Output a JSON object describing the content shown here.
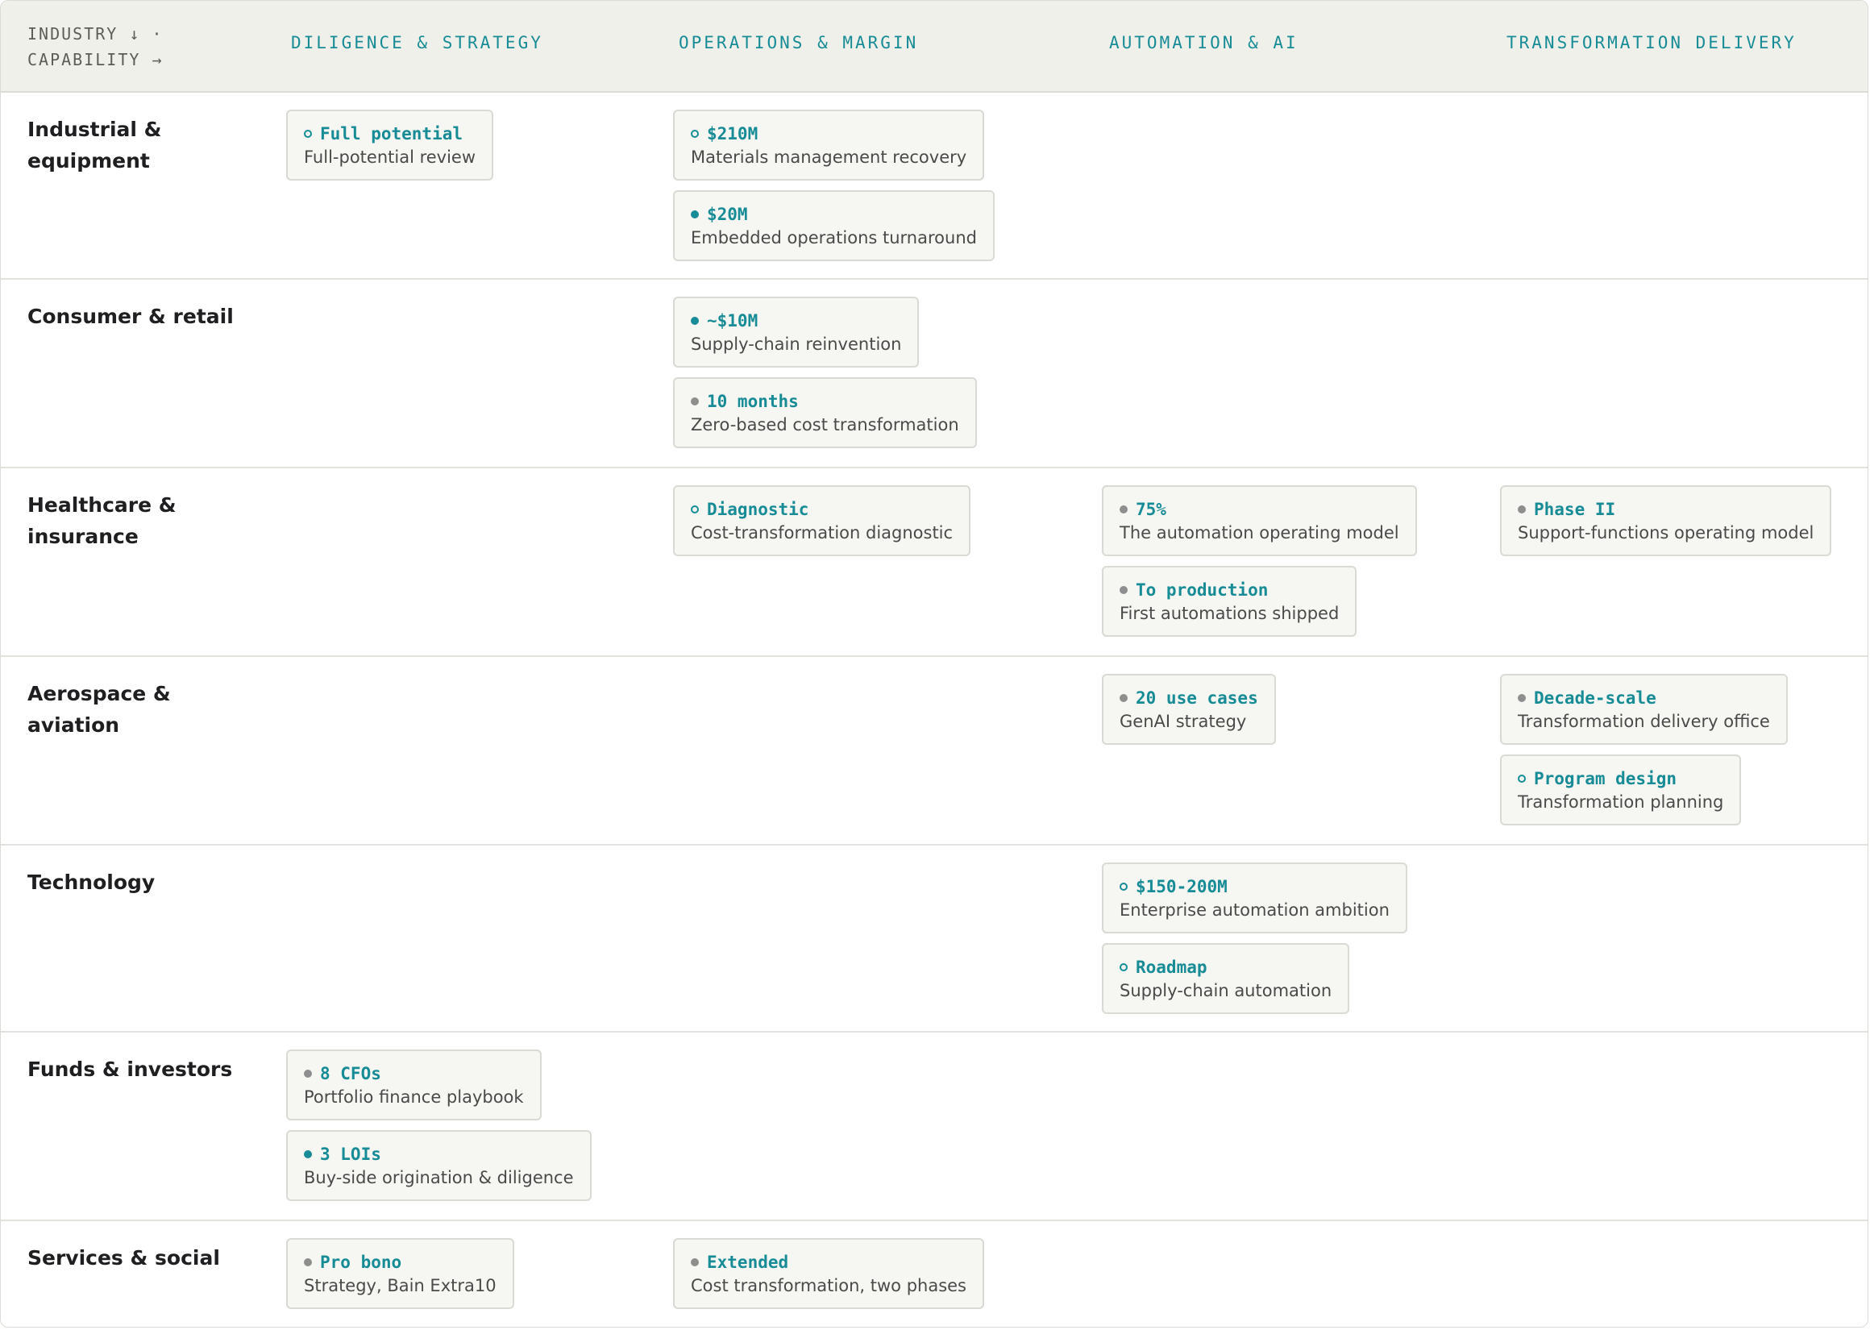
{
  "header": {
    "corner_line1": "INDUSTRY ↓ ·",
    "corner_line2": "CAPABILITY →",
    "columns": [
      "DILIGENCE & STRATEGY",
      "OPERATIONS & MARGIN",
      "AUTOMATION & AI",
      "TRANSFORMATION DELIVERY"
    ]
  },
  "rows": [
    {
      "label": "Industrial & equipment",
      "cells": [
        [
          {
            "status": "outline",
            "metric": "Full potential",
            "desc": "Full-potential review"
          }
        ],
        [
          {
            "status": "outline",
            "metric": "$210M",
            "desc": "Materials management recovery"
          },
          {
            "status": "filled",
            "metric": "$20M",
            "desc": "Embedded operations turnaround"
          }
        ],
        [],
        []
      ]
    },
    {
      "label": "Consumer & retail",
      "cells": [
        [],
        [
          {
            "status": "filled",
            "metric": "~$10M",
            "desc": "Supply-chain reinvention"
          },
          {
            "status": "grey",
            "metric": "10 months",
            "desc": "Zero-based cost transformation"
          }
        ],
        [],
        []
      ]
    },
    {
      "label": "Healthcare & insurance",
      "cells": [
        [],
        [
          {
            "status": "outline",
            "metric": "Diagnostic",
            "desc": "Cost-transformation diagnostic"
          }
        ],
        [
          {
            "status": "grey",
            "metric": "75%",
            "desc": "The automation operating model"
          },
          {
            "status": "grey",
            "metric": "To production",
            "desc": "First automations shipped"
          }
        ],
        [
          {
            "status": "grey",
            "metric": "Phase II",
            "desc": "Support-functions operating model"
          }
        ]
      ]
    },
    {
      "label": "Aerospace & aviation",
      "cells": [
        [],
        [],
        [
          {
            "status": "grey",
            "metric": "20 use cases",
            "desc": "GenAI strategy"
          }
        ],
        [
          {
            "status": "grey",
            "metric": "Decade-scale",
            "desc": "Transformation delivery office"
          },
          {
            "status": "outline",
            "metric": "Program design",
            "desc": "Transformation planning"
          }
        ]
      ]
    },
    {
      "label": "Technology",
      "cells": [
        [],
        [],
        [
          {
            "status": "outline",
            "metric": "$150-200M",
            "desc": "Enterprise automation ambition"
          },
          {
            "status": "outline",
            "metric": "Roadmap",
            "desc": "Supply-chain automation"
          }
        ],
        []
      ]
    },
    {
      "label": "Funds & investors",
      "cells": [
        [
          {
            "status": "grey",
            "metric": "8 CFOs",
            "desc": "Portfolio finance playbook"
          },
          {
            "status": "filled",
            "metric": "3 LOIs",
            "desc": "Buy-side origination & diligence"
          }
        ],
        [],
        [],
        []
      ]
    },
    {
      "label": "Services & social",
      "cells": [
        [
          {
            "status": "grey",
            "metric": "Pro bono",
            "desc": "Strategy, Bain Extra10"
          }
        ],
        [
          {
            "status": "grey",
            "metric": "Extended",
            "desc": "Cost transformation, two phases"
          }
        ],
        [],
        []
      ]
    }
  ]
}
